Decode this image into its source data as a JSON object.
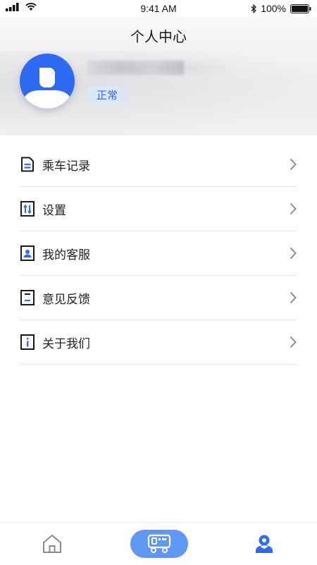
{
  "status_bar": {
    "time": "9:41 AM",
    "battery_percent": "100%",
    "icons": [
      "signal-icon",
      "wifi-icon",
      "bluetooth-icon",
      "battery-icon"
    ]
  },
  "header": {
    "title": "个人中心",
    "avatar_icon": "user-avatar-icon",
    "status_badge": "正常"
  },
  "menu": {
    "items": [
      {
        "label": "乘车记录",
        "icon": "document-icon"
      },
      {
        "label": "设置",
        "icon": "sliders-icon"
      },
      {
        "label": "我的客服",
        "icon": "contact-icon"
      },
      {
        "label": "意见反馈",
        "icon": "feedback-icon"
      },
      {
        "label": "关于我们",
        "icon": "info-icon"
      }
    ]
  },
  "tabbar": {
    "tabs": [
      {
        "name": "home",
        "icon": "home-icon"
      },
      {
        "name": "ride",
        "icon": "bus-icon",
        "active_pill": true
      },
      {
        "name": "profile",
        "icon": "profile-icon",
        "selected": true
      }
    ]
  },
  "colors": {
    "accent": "#2e6bf5",
    "badge_bg": "#dbe6f7",
    "pill": "#5f97f5",
    "tab_inactive": "#8a8a8a"
  }
}
